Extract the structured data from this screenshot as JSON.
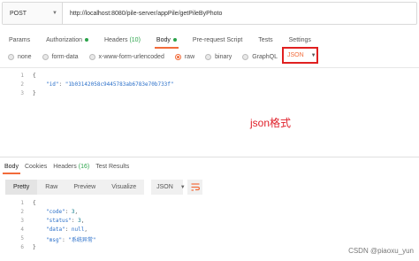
{
  "request": {
    "method": "POST",
    "url": "http://localhost:8080/pile-server/appPile/getPileByPhoto"
  },
  "request_tabs": [
    {
      "label": "Params"
    },
    {
      "label": "Authorization"
    },
    {
      "label": "Headers",
      "count": "(10)"
    },
    {
      "label": "Body"
    },
    {
      "label": "Pre-request Script"
    },
    {
      "label": "Tests"
    },
    {
      "label": "Settings"
    }
  ],
  "body_options": [
    "none",
    "form-data",
    "x-www-form-urlencoded",
    "raw",
    "binary",
    "GraphQL"
  ],
  "body_format": "JSON",
  "request_body": {
    "line_numbers": [
      "1",
      "2",
      "3"
    ],
    "open": "{",
    "key": "\"id\"",
    "colon": ":",
    "value": "\"1b03142058c9445783ab6783e70b733f\"",
    "close": "}"
  },
  "annotation": "json格式",
  "response_tabs": [
    {
      "label": "Body"
    },
    {
      "label": "Cookies"
    },
    {
      "label": "Headers",
      "count": "(16)"
    },
    {
      "label": "Test Results"
    }
  ],
  "response_views": [
    "Pretty",
    "Raw",
    "Preview",
    "Visualize"
  ],
  "response_format": "JSON",
  "response_body": {
    "line_numbers": [
      "1",
      "2",
      "3",
      "4",
      "5",
      "6"
    ],
    "open": "{",
    "code_key": "\"code\"",
    "code_val": "3",
    "status_key": "\"status\"",
    "status_val": "3",
    "data_key": "\"data\"",
    "data_val": "null",
    "msg_key": "\"msg\"",
    "msg_val": "\"系统异常\"",
    "close": "}"
  },
  "watermark": "CSDN @piaoxu_yun",
  "colors": {
    "accent": "#f26b3a",
    "highlight_border": "#e02020",
    "annotation": "#e0202a",
    "status_dot": "#2ba34a"
  }
}
